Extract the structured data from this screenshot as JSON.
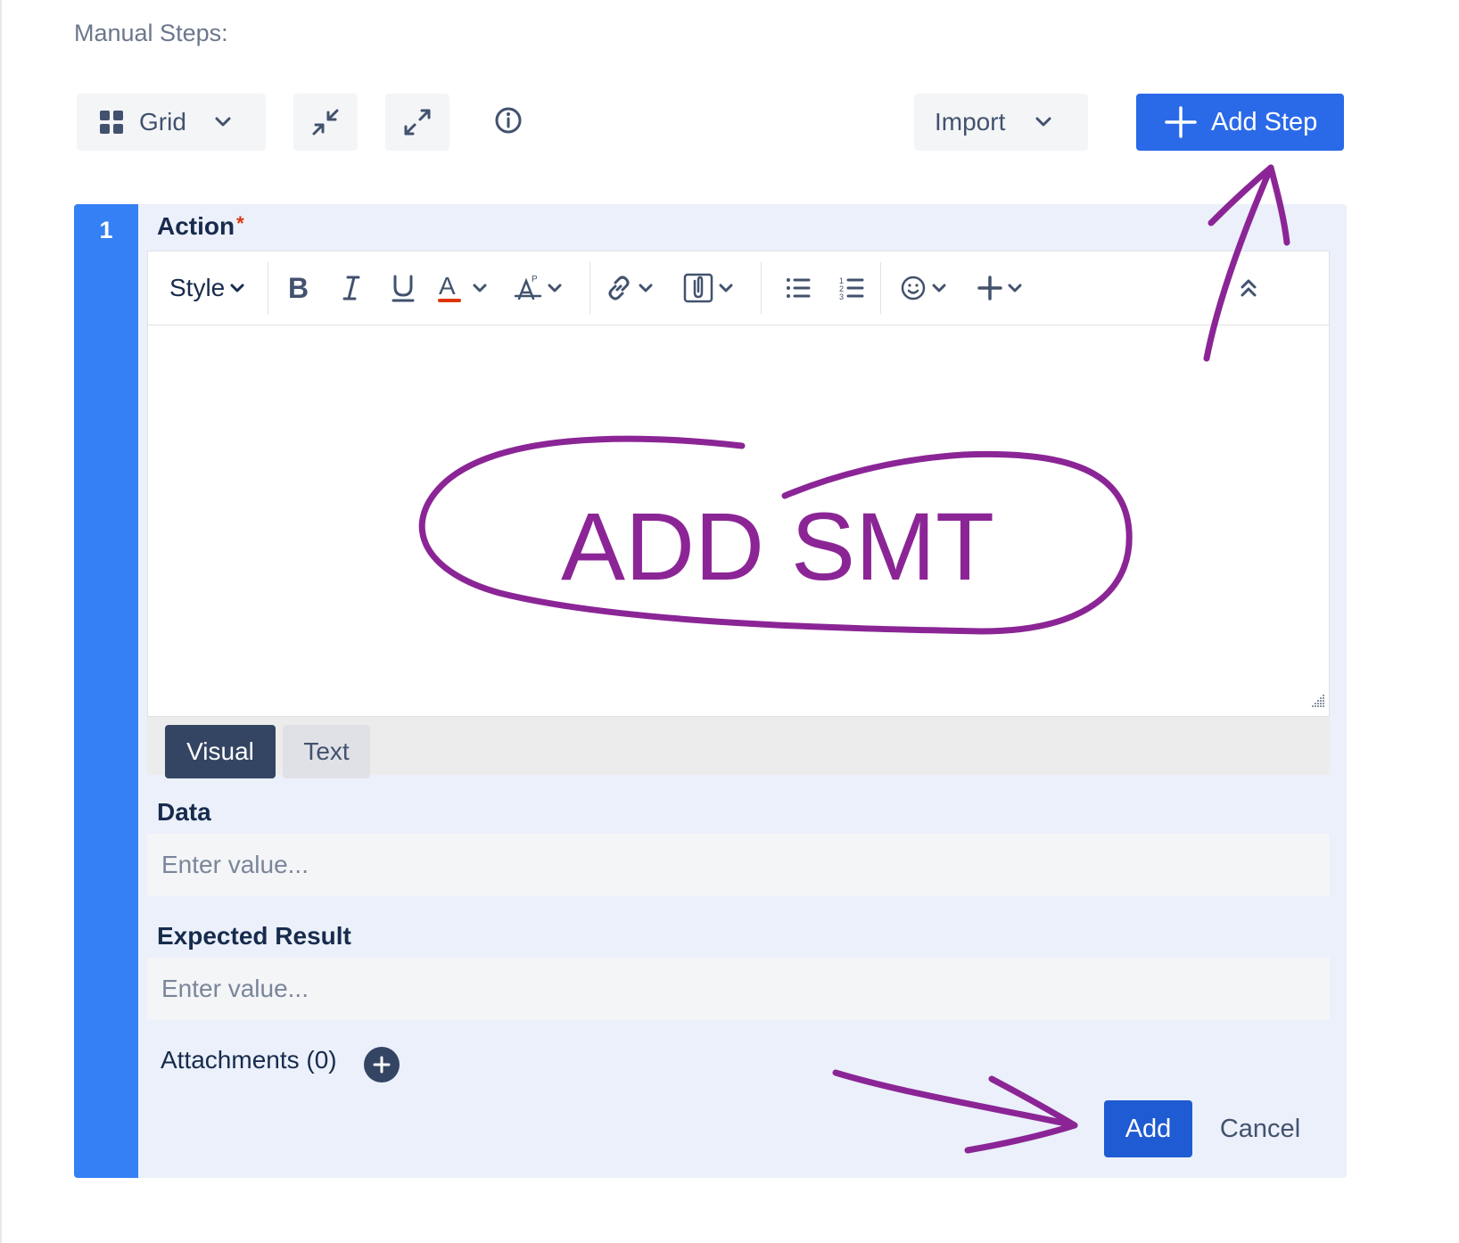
{
  "section": {
    "title": "Manual Steps:"
  },
  "toolbar": {
    "view_select": {
      "label": "Grid",
      "icon": "grid-icon"
    },
    "collapse_icon": "collapse-arrows-icon",
    "expand_icon": "expand-arrows-icon",
    "info_icon": "info-icon",
    "import_label": "Import",
    "add_step_label": "Add Step"
  },
  "step": {
    "number": "1",
    "action": {
      "label": "Action",
      "required_mark": "*",
      "editor_toolbar": {
        "style_label": "Style",
        "tools": [
          "bold-icon",
          "italic-icon",
          "underline-icon",
          "text-color-icon",
          "clear-format-icon",
          "link-icon",
          "attachment-icon",
          "bullet-list-icon",
          "numbered-list-icon",
          "emoji-icon",
          "insert-more-icon",
          "collapse-toolbar-icon"
        ]
      },
      "tabs": {
        "visual": "Visual",
        "text": "Text"
      },
      "annotation_text": "ADD SMT"
    },
    "data": {
      "label": "Data",
      "placeholder": "Enter value..."
    },
    "expected_result": {
      "label": "Expected Result",
      "placeholder": "Enter value..."
    },
    "attachments": {
      "label": "Attachments (0)"
    },
    "add_label": "Add",
    "cancel_label": "Cancel"
  },
  "colors": {
    "primary": "#2a6ae9",
    "primary_dark": "#1f5bd2",
    "step_bar": "#3580f5",
    "card_bg": "#ebf0fa",
    "annotation": "#8b2596",
    "required": "#de350b"
  }
}
